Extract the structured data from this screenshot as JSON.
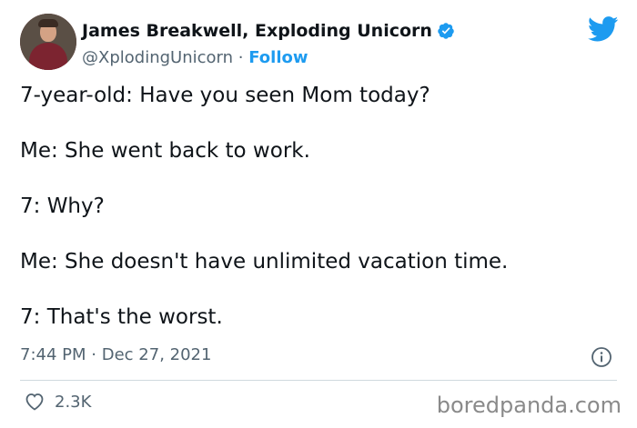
{
  "author": {
    "name": "James Breakwell, Exploding Unicorn",
    "handle": "@XplodingUnicorn",
    "separator": "·",
    "follow_label": "Follow"
  },
  "tweet": {
    "lines": [
      "7-year-old: Have you seen Mom today?",
      "Me: She went back to work.",
      "7: Why?",
      "Me: She doesn't have unlimited vacation time.",
      "7: That's the worst."
    ],
    "time": "7:44 PM",
    "date": "Dec 27, 2021",
    "likes": "2.3K"
  },
  "watermark": "boredpanda.com",
  "icons": {
    "verified": "verified-badge-icon",
    "platform": "twitter-bird-icon",
    "info": "info-icon",
    "like": "heart-icon"
  },
  "colors": {
    "accent": "#1d9bf0",
    "text": "#0f1419",
    "secondary": "#536471",
    "divider": "#cfd9de"
  }
}
